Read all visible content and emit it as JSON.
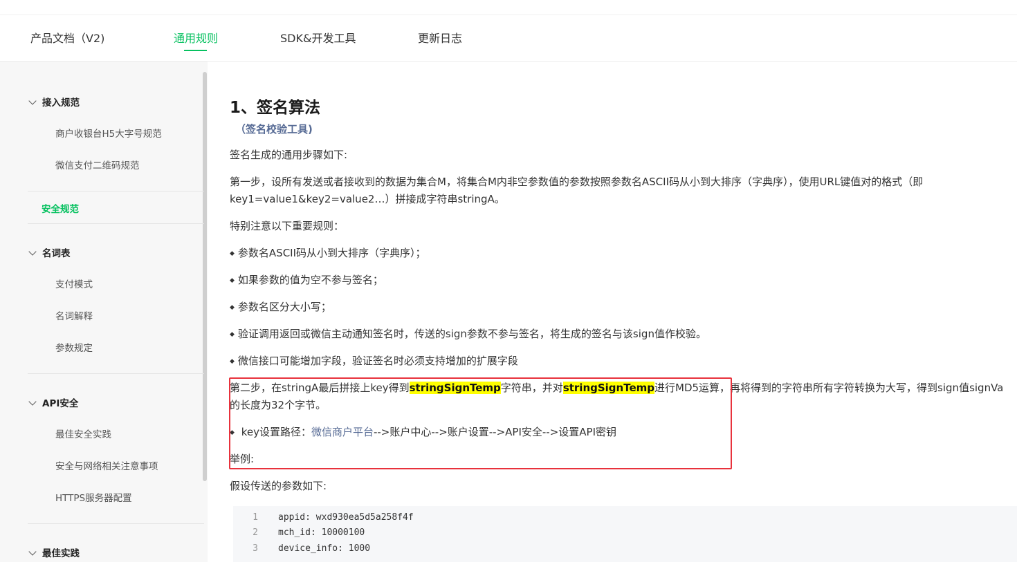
{
  "nav": {
    "items": [
      {
        "label": "产品文档（V2)"
      },
      {
        "label": "通用规则"
      },
      {
        "label": "SDK&开发工具"
      },
      {
        "label": "更新日志"
      }
    ],
    "active": "通用规则"
  },
  "sidebar": {
    "groups": [
      {
        "label": "接入规范",
        "items": [
          "商户收银台H5大字号规范",
          "微信支付二维码规范"
        ]
      },
      {
        "label": "安全规范"
      },
      {
        "label": "名词表",
        "items": [
          "支付模式",
          "名词解释",
          "参数规定"
        ]
      },
      {
        "label": "API安全",
        "items": [
          "最佳安全实践",
          "安全与网络相关注意事项",
          "HTTPS服务器配置"
        ]
      },
      {
        "label": "最佳实践"
      }
    ]
  },
  "content": {
    "title": "1、签名算法",
    "tool_link": "（签名校验工具)",
    "intro": "签名生成的通用步骤如下:",
    "step1_line1": "第一步，设所有发送或者接收到的数据为集合M，将集合M内非空参数值的参数按照参数名ASCII码从小到大排序（字典序），使用URL键值对的格式（即",
    "step1_line2": "key1=value1&key2=value2…）拼接成字符串stringA。",
    "notice": "特别注意以下重要规则：",
    "rules": [
      "参数名ASCII码从小到大排序（字典序）；",
      "如果参数的值为空不参与签名；",
      "参数名区分大小写；",
      "验证调用返回或微信主动通知签名时，传送的sign参数不参与签名，将生成的签名与该sign值作校验。",
      "微信接口可能增加字段，验证签名时必须支持增加的扩展字段"
    ],
    "step2": {
      "part1": "第二步，在stringA最后拼接上key得到",
      "hl1": "stringSignTemp",
      "part2": "字符串，并对",
      "hl2": "stringSignTemp",
      "part3": "进行MD5运算，再将得到的字符串所有字符转换为大写，得到sign值signVa",
      "line2": "的长度为32个字节。"
    },
    "key_path": {
      "prefix": "key设置路径：",
      "link": "微信商户平台",
      "suffix": "-->账户中心-->账户设置-->API安全-->设置API密钥"
    },
    "example": "举例:",
    "params_intro": "假设传送的参数如下:",
    "code": [
      {
        "ln": "1",
        "text": "appid:  wxd930ea5d5a258f4f"
      },
      {
        "ln": "2",
        "text": "mch_id:  10000100"
      },
      {
        "ln": "3",
        "text": "device_info:  1000"
      }
    ]
  },
  "colors": {
    "accent": "#07c160",
    "link": "#576b95",
    "highlight": "#ffff00",
    "annotation": "#e8323c"
  }
}
